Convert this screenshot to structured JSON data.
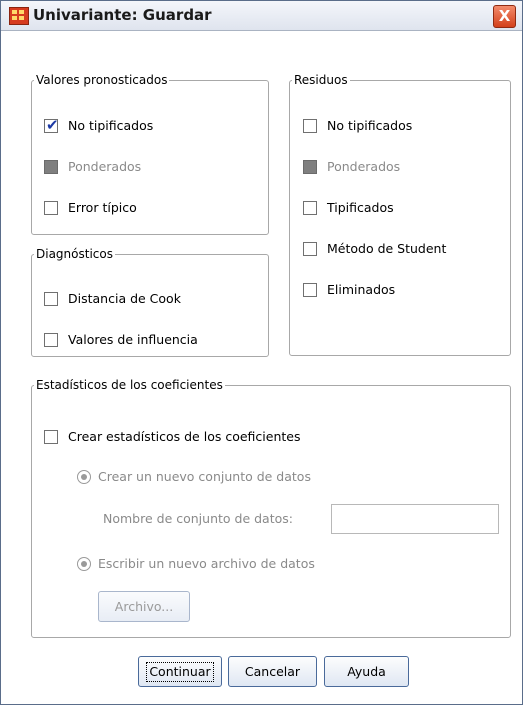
{
  "window": {
    "title": "Univariante: Guardar",
    "close_label": "X"
  },
  "valores": {
    "legend": "Valores pronosticados",
    "items": [
      {
        "label": "No tipificados",
        "checked": true,
        "enabled": true
      },
      {
        "label": "Ponderados",
        "checked": false,
        "enabled": false
      },
      {
        "label": "Error típico",
        "checked": false,
        "enabled": true
      }
    ]
  },
  "residuos": {
    "legend": "Residuos",
    "items": [
      {
        "label": "No tipificados",
        "checked": false,
        "enabled": true
      },
      {
        "label": "Ponderados",
        "checked": false,
        "enabled": false
      },
      {
        "label": "Tipificados",
        "checked": false,
        "enabled": true
      },
      {
        "label": "Método de Student",
        "checked": false,
        "enabled": true
      },
      {
        "label": "Eliminados",
        "checked": false,
        "enabled": true
      }
    ]
  },
  "diagnosticos": {
    "legend": "Diagnósticos",
    "items": [
      {
        "label": "Distancia de Cook",
        "checked": false,
        "enabled": true
      },
      {
        "label": "Valores de influencia",
        "checked": false,
        "enabled": true
      }
    ]
  },
  "coeficientes": {
    "legend": "Estadísticos de los coeficientes",
    "create_label": "Crear estadísticos de los coeficientes",
    "radio_new_dataset": "Crear un nuevo conjunto de datos",
    "dataset_name_label": "Nombre de conjunto de datos:",
    "dataset_name_value": "",
    "radio_new_file": "Escribir un nuevo archivo de datos",
    "file_button": "Archivo..."
  },
  "buttons": {
    "continue": "Continuar",
    "cancel": "Cancelar",
    "help": "Ayuda"
  }
}
